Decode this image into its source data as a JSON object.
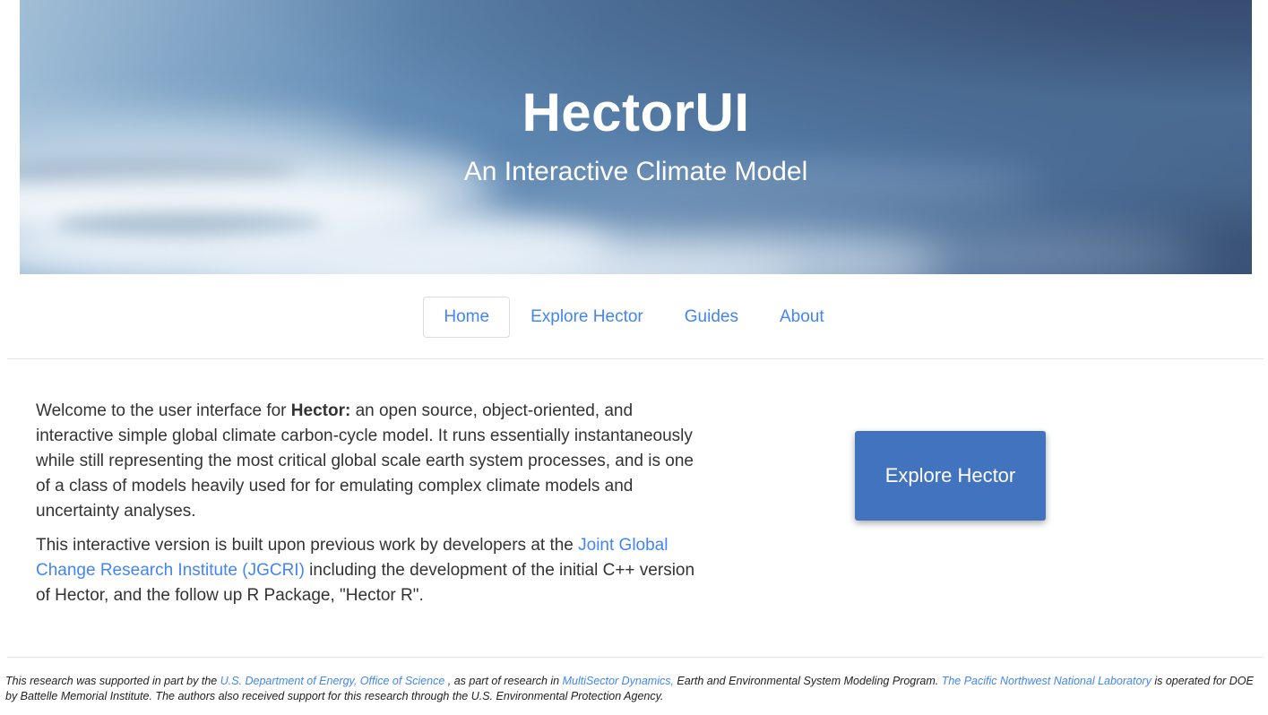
{
  "banner": {
    "title": "HectorUI",
    "subtitle": "An Interactive Climate Model",
    "colors": {
      "sky_light": "#6b95bd",
      "sky_dark": "#39506e",
      "cloud": "#e8f1f8"
    }
  },
  "nav": {
    "items": [
      {
        "label": "Home",
        "active": true
      },
      {
        "label": "Explore Hector",
        "active": false
      },
      {
        "label": "Guides",
        "active": false
      },
      {
        "label": "About",
        "active": false
      }
    ],
    "link_color": "#4285f4"
  },
  "main": {
    "intro": {
      "lead": "Welcome to the user interface for ",
      "bold": "Hector:",
      "rest": " an open source, object-oriented, and interactive simple global climate carbon-cycle model. It runs essentially instantaneously while still representing the most critical global scale earth system processes, and is one of a class of models heavily used for for emulating complex climate models and uncertainty analyses."
    },
    "credit": {
      "before_link": "This interactive version is built upon previous work by developers at the ",
      "link": "Joint Global Change Research Institute (JGCRI)",
      "after_link": " including the development of the initial C++ version of Hector, and the follow up R Package, \"Hector R\"."
    },
    "explore_button": {
      "label": "Explore Hector",
      "color": "#4273be"
    }
  },
  "footer": {
    "s1": "This research was supported in part by the ",
    "link1": "U.S. Department of Energy, Office of Science",
    "s2": " , as part of research in ",
    "link2": "MultiSector Dynamics,",
    "s3": " Earth and Environmental System Modeling Program. ",
    "link3": "The Pacific Northwest National Laboratory",
    "s4": " is operated for DOE by Battelle Memorial Institute. The authors also received support for this research through the U.S. Environmental Protection Agency."
  }
}
